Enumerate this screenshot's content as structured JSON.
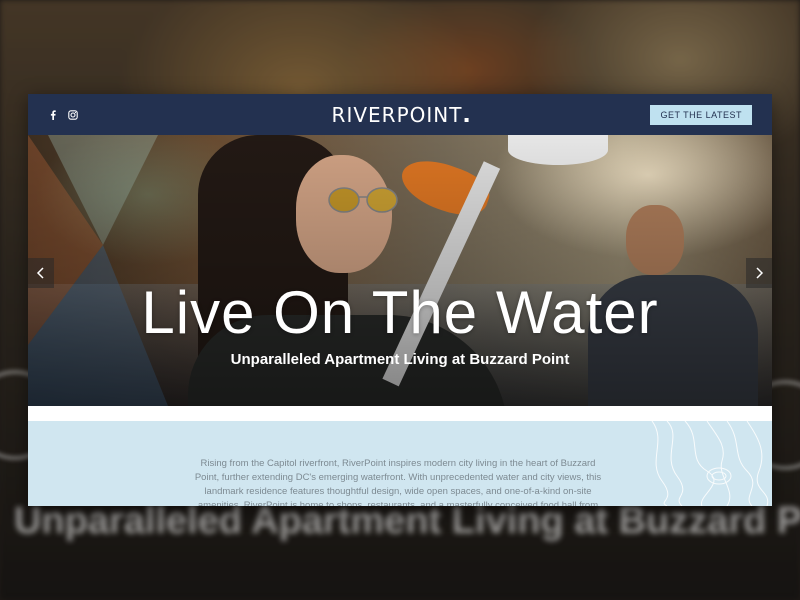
{
  "header": {
    "logo": "RIVERPOINT",
    "cta_label": "GET THE LATEST",
    "social": [
      "facebook-icon",
      "instagram-icon"
    ]
  },
  "hero": {
    "title": "Live On The Water",
    "subtitle": "Unparalleled Apartment Living at Buzzard Point"
  },
  "intro": {
    "text": "Rising from the Capitol riverfront, RiverPoint inspires modern city living in the heart of Buzzard Point, further extending DC's emerging waterfront. With unprecedented water and city views, this landmark residence features thoughtful design, wide open spaces, and one-of-a-kind on-site amenities. RiverPoint is home to shops, restaurants, and a masterfully conceived food hall from James Beard award-winning"
  },
  "backdrop": {
    "subtitle": "Unparalleled Apartment Living at Buzzard Point"
  },
  "colors": {
    "header_bg": "#233150",
    "cta_bg": "#bfe1f0",
    "intro_bg": "#d0e6f0",
    "intro_text": "#7d8a92",
    "paddle_orange": "#e57a24"
  }
}
